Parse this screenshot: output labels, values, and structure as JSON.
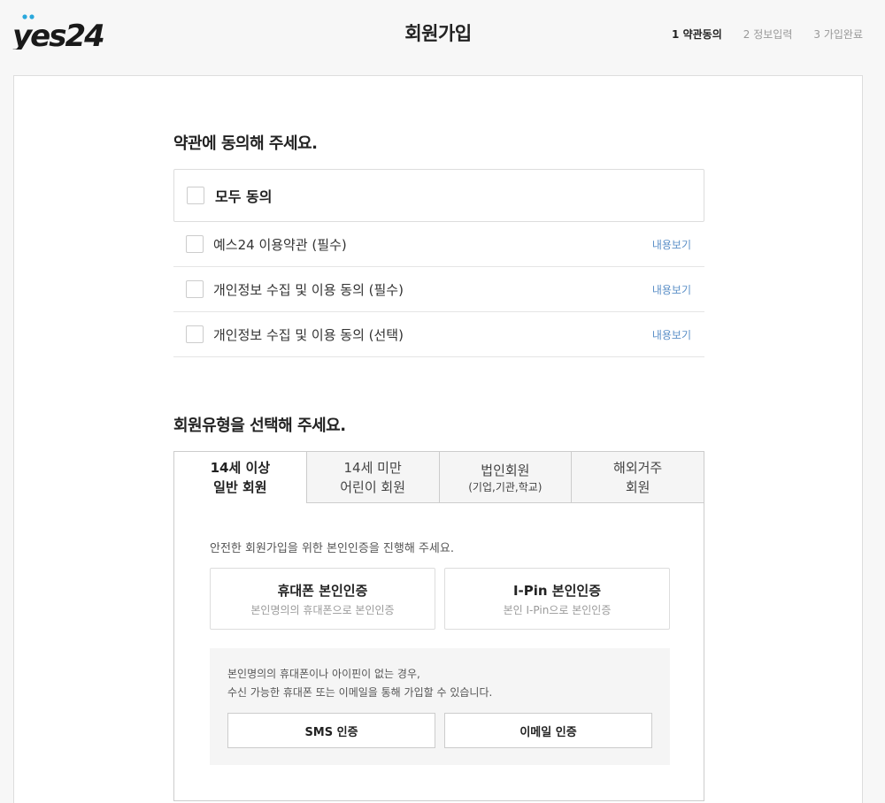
{
  "header": {
    "logo_text": "yes24",
    "title": "회원가입",
    "steps": [
      {
        "label": "1 약관동의",
        "active": true
      },
      {
        "label": "2 정보입력",
        "active": false
      },
      {
        "label": "3 가입완료",
        "active": false
      }
    ]
  },
  "terms": {
    "title": "약관에 동의해 주세요.",
    "all_agree_label": "모두 동의",
    "items": [
      {
        "label": "예스24 이용약관 (필수)",
        "view": "내용보기"
      },
      {
        "label": "개인정보 수집 및 이용 동의 (필수)",
        "view": "내용보기"
      },
      {
        "label": "개인정보 수집 및 이용 동의 (선택)",
        "view": "내용보기"
      }
    ]
  },
  "member_type": {
    "title": "회원유형을 선택해 주세요.",
    "tabs": [
      {
        "line1": "14세 이상",
        "line2": "일반 회원",
        "sub": ""
      },
      {
        "line1": "14세 미만",
        "line2": "어린이 회원",
        "sub": ""
      },
      {
        "line1": "법인회원",
        "line2": "",
        "sub": "(기업,기관,학교)"
      },
      {
        "line1": "해외거주",
        "line2": "회원",
        "sub": ""
      }
    ],
    "intro": "안전한 회원가입을 위한 본인인증을 진행해 주세요.",
    "phone_auth": {
      "title": "휴대폰 본인인증",
      "sub": "본인명의의 휴대폰으로 본인인증"
    },
    "ipin_auth": {
      "title": "I-Pin 본인인증",
      "sub": "본인 I-Pin으로 본인인증"
    },
    "alt": {
      "line1": "본인명의의 휴대폰이나 아이핀이 없는 경우,",
      "line2": "수신 가능한 휴대폰 또는 이메일을 통해 가입할 수 있습니다.",
      "sms_label": "SMS 인증",
      "email_label": "이메일 인증"
    }
  }
}
